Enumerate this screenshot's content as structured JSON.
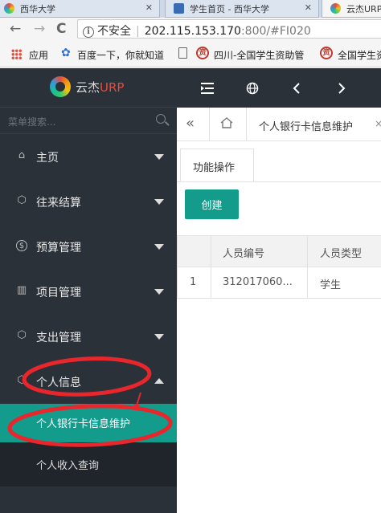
{
  "browser": {
    "tabs": [
      {
        "title": "西华大学"
      },
      {
        "title": "学生首页 - 西华大学"
      },
      {
        "title": "云杰URP"
      }
    ],
    "nav": {
      "back": "←",
      "forward": "→",
      "reload": "C"
    },
    "address": {
      "security_label": "不安全",
      "host": "202.115.153.170",
      "path": ":800/#FI020"
    },
    "bookmarks": [
      {
        "label": "应用"
      },
      {
        "label": "百度一下，你就知道"
      },
      {
        "label": "四川-全国学生资助管"
      },
      {
        "label": "全国学生资"
      }
    ]
  },
  "sidebar": {
    "brand": "云杰",
    "brand_accent": "URP",
    "search_placeholder": "菜单搜索...",
    "items": [
      {
        "label": "主页",
        "icon": "⌂"
      },
      {
        "label": "往来结算",
        "icon": "⬡"
      },
      {
        "label": "预算管理",
        "icon": "$"
      },
      {
        "label": "项目管理",
        "icon": "▥"
      },
      {
        "label": "支出管理",
        "icon": "⬡"
      },
      {
        "label": "个人信息",
        "icon": "⬡"
      }
    ],
    "submenu": [
      {
        "label": "个人银行卡信息维护"
      },
      {
        "label": "个人收入查询"
      }
    ]
  },
  "topbar": {
    "icons": [
      "menu-toggle-icon",
      "globe-icon",
      "prev-icon",
      "next-icon"
    ]
  },
  "tabs": {
    "collapse": "«",
    "page_tab": "个人银行卡信息维护",
    "close": "×"
  },
  "content": {
    "subtab": "功能操作",
    "create_button": "创建",
    "table": {
      "columns": [
        "人员编号",
        "人员类型"
      ],
      "rows": [
        {
          "index": "1",
          "id": "312017060...",
          "type": "学生"
        }
      ]
    }
  },
  "colors": {
    "accent": "#139b8c",
    "sidebar": "#2a3139",
    "annotation": "#e8262b"
  }
}
